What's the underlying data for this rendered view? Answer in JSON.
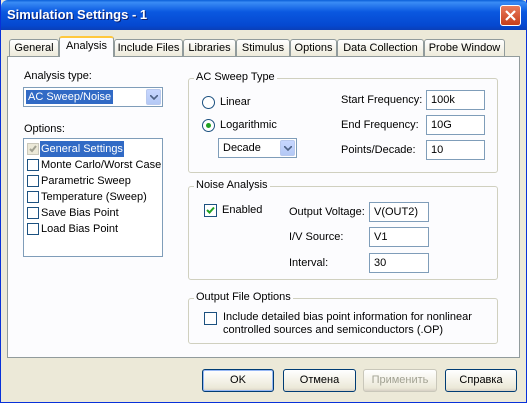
{
  "window": {
    "title": "Simulation Settings - 1"
  },
  "tabs": [
    {
      "label": "General"
    },
    {
      "label": "Analysis"
    },
    {
      "label": "Include Files"
    },
    {
      "label": "Libraries"
    },
    {
      "label": "Stimulus"
    },
    {
      "label": "Options"
    },
    {
      "label": "Data Collection"
    },
    {
      "label": "Probe Window"
    }
  ],
  "analysis_type": {
    "label": "Analysis type:",
    "value": "AC Sweep/Noise"
  },
  "options": {
    "label": "Options:",
    "items": [
      {
        "label": "General Settings",
        "checked": true,
        "selected": true
      },
      {
        "label": "Monte Carlo/Worst Case",
        "checked": false
      },
      {
        "label": "Parametric Sweep",
        "checked": false
      },
      {
        "label": "Temperature (Sweep)",
        "checked": false
      },
      {
        "label": "Save Bias Point",
        "checked": false
      },
      {
        "label": "Load Bias Point",
        "checked": false
      }
    ]
  },
  "ac_sweep": {
    "title": "AC Sweep Type",
    "linear_label": "Linear",
    "log_label": "Logarithmic",
    "selected": "Logarithmic",
    "scale_value": "Decade",
    "start_freq_label": "Start Frequency:",
    "start_freq": "100k",
    "end_freq_label": "End Frequency:",
    "end_freq": "10G",
    "points_label": "Points/Decade:",
    "points": "10"
  },
  "noise": {
    "title": "Noise Analysis",
    "enabled_label": "Enabled",
    "enabled": true,
    "output_voltage_label": "Output Voltage:",
    "output_voltage": "V(OUT2)",
    "iv_source_label": "I/V Source:",
    "iv_source": "V1",
    "interval_label": "Interval:",
    "interval": "30"
  },
  "output_file": {
    "title": "Output File Options",
    "include_label_line1": "Include detailed bias point information for nonlinear",
    "include_label_line2": "controlled sources and semiconductors (.OP)",
    "checked": false
  },
  "buttons": {
    "ok": "OK",
    "cancel": "Отмена",
    "apply": "Применить",
    "help": "Справка"
  },
  "colors": {
    "titlebar": "#0a58e0",
    "selection": "#316ac5",
    "radio_dot": "#21a121",
    "check_mark": "#21a121"
  }
}
